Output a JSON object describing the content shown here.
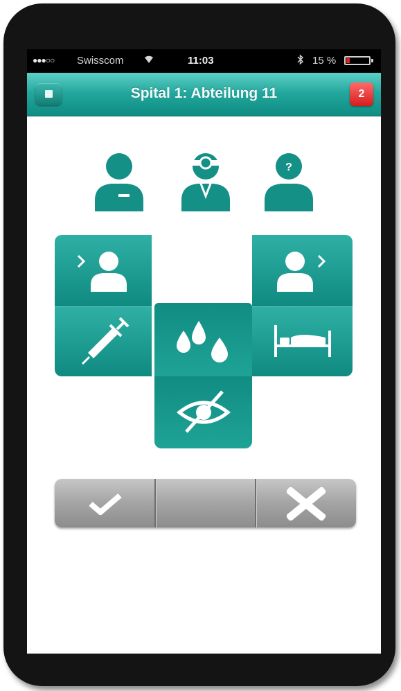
{
  "statusbar": {
    "signal": "●●●○○",
    "carrier": "Swisscom",
    "time": "11:03",
    "battery_text": "15 %",
    "battery_level": 0.15,
    "battery_color": "#e42020"
  },
  "navbar": {
    "title": "Spital 1: Abteilung 11",
    "badge_count": "2",
    "accent": "#22a69c"
  },
  "people": [
    {
      "icon": "nurse-person-icon"
    },
    {
      "icon": "doctor-person-icon"
    },
    {
      "icon": "unknown-person-icon"
    }
  ],
  "tiles": [
    {
      "icon": "patient-arriving-icon"
    },
    {
      "icon": "patient-leaving-icon"
    },
    {
      "icon": "syringe-icon"
    },
    {
      "icon": "fluid-drops-icon"
    },
    {
      "icon": "bed-icon"
    },
    {
      "icon": "eye-hidden-icon"
    }
  ],
  "actions": [
    {
      "icon": "checkmark-icon"
    },
    {
      "icon": "empty-action"
    },
    {
      "icon": "close-icon"
    }
  ],
  "colors": {
    "teal_dark": "#0f8a80",
    "teal_light": "#2fb0a5",
    "phone_frame": "#141414"
  }
}
